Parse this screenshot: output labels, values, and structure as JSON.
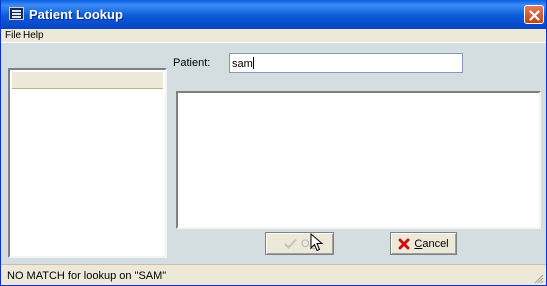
{
  "window": {
    "title": "Patient Lookup",
    "app_icon": "app-icon",
    "close_icon": "close-icon"
  },
  "menu": [
    {
      "label": "File"
    },
    {
      "label": "Help"
    }
  ],
  "lookup": {
    "label": "Patient:",
    "value": "sam"
  },
  "results": {
    "items": []
  },
  "buttons": {
    "ok": {
      "label_prefix": "O",
      "label_underline": "k",
      "enabled": false,
      "icon": "checkmark-icon"
    },
    "cancel": {
      "label_prefix": "",
      "label_underline": "C",
      "label_rest": "ancel",
      "enabled": true,
      "icon": "x-icon"
    }
  },
  "status": {
    "message": "NO MATCH for lookup on \"SAM\""
  },
  "colors": {
    "titlebar": "#0a5ad8",
    "client_background": "#d4dde0",
    "cancel_icon_red": "#cc1010",
    "disabled_text": "#b4b4b4"
  }
}
